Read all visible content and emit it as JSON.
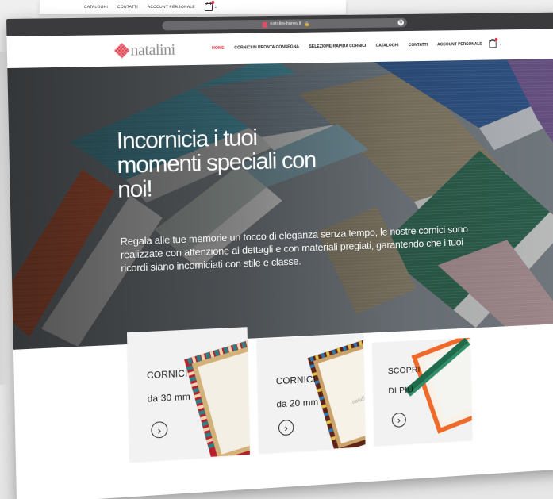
{
  "background_window": {
    "nav": [
      "CATALOGHI",
      "CONTATTI",
      "ACCOUNT PERSONALE"
    ]
  },
  "browser": {
    "url": "natalini-bores.it",
    "lock_icon": "lock-icon",
    "reload_icon": "reload-icon"
  },
  "site": {
    "logo_text": "natalini",
    "logo_mark": "logo-diamond-icon",
    "nav": {
      "home": "HOME",
      "quick": "CORNICI IN PRONTA CONSEGNA",
      "selection": "SELEZIONE RAPIDA CORNICI",
      "catalogs": "CATALOGHI",
      "contacts": "CONTATTI",
      "account": "ACCOUNT PERSONALE",
      "cart_icon": "shopping-bag-icon",
      "chevron_icon": "chevron-down-icon"
    },
    "colors": {
      "accent": "#d83141",
      "logo_gray": "#8d8d8d"
    }
  },
  "hero": {
    "title": "Incornicia i tuoi momenti speciali con noi!",
    "subtitle": "Regala alle tue memorie un tocco di eleganza senza tempo, le nostre cornici sono realizzate con attenzione ai dettagli e con materiali pregiati, garantendo che i tuoi ricordi siano incorniciati con stile e classe."
  },
  "cards": [
    {
      "line1": "CORNICI",
      "line2": "da 30 mm",
      "arrow_icon": "arrow-right-circle-icon",
      "frame_colors": [
        "#b81f2b",
        "#2f7f82",
        "#e7d3b2"
      ]
    },
    {
      "line1": "CORNICI",
      "line2": "da 20 mm",
      "arrow_icon": "arrow-right-circle-icon",
      "frame_colors": [
        "#5e2417",
        "#2e79b2",
        "#dfc04b"
      ]
    },
    {
      "line1": "SCOPRI",
      "line2": "DI PIÙ",
      "arrow_icon": "arrow-right-circle-icon",
      "frame_colors": [
        "#ef6a2a",
        "#1f6c4c",
        "#f6f0e8"
      ]
    }
  ]
}
